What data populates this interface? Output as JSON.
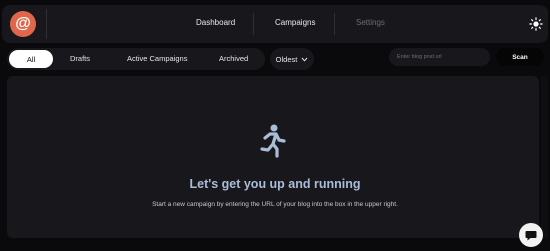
{
  "header": {
    "logo_glyph": "@",
    "nav": [
      {
        "label": "Dashboard",
        "active": true
      },
      {
        "label": "Campaigns",
        "active": true
      },
      {
        "label": "Settings",
        "active": false
      }
    ],
    "theme_icon": "sun-icon"
  },
  "filters": {
    "tabs": [
      "All",
      "Drafts",
      "Active Campaigns",
      "Archived"
    ],
    "selected": "All",
    "sort_value": "Oldest"
  },
  "scan": {
    "placeholder": "Enter blog post url",
    "button_label": "Scan"
  },
  "empty_state": {
    "icon": "running-person-icon",
    "title": "Let's get you up and running",
    "subtitle": "Start a new campaign by entering the URL of your blog into the box in the upper right."
  },
  "chat": {
    "icon": "chat-bubble-icon"
  },
  "colors": {
    "accent": "#e0674c",
    "title": "#a9bdd8",
    "panel": "#18181c",
    "background": "#0a0a0c"
  }
}
